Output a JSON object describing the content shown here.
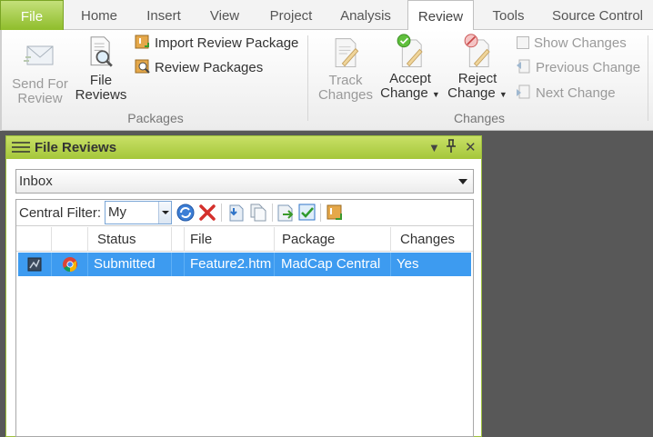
{
  "ribbon_tabs": [
    "File",
    "Home",
    "Insert",
    "View",
    "Project",
    "Analysis",
    "Review",
    "Tools",
    "Source Control"
  ],
  "active_tab": "Review",
  "ribbon": {
    "packages": {
      "send_for_review": [
        "Send For",
        "Review"
      ],
      "file_reviews": [
        "File",
        "Reviews"
      ],
      "import_review_package": "Import Review Package",
      "review_packages": "Review Packages",
      "group_label": "Packages"
    },
    "changes": {
      "track_changes": [
        "Track",
        "Changes"
      ],
      "accept_change": [
        "Accept",
        "Change"
      ],
      "reject_change": [
        "Reject",
        "Change"
      ],
      "show_changes": "Show Changes",
      "previous_change": "Previous Change",
      "next_change": "Next Change",
      "group_label": "Changes"
    }
  },
  "panel": {
    "title": "File Reviews",
    "inbox_value": "Inbox",
    "filter_label": "Central Filter:",
    "filter_value": "My",
    "columns": [
      "Status",
      "File",
      "Package",
      "Changes"
    ],
    "rows": [
      {
        "status": "Submitted",
        "file": "Feature2.htm",
        "package": "MadCap Central",
        "changes": "Yes"
      }
    ]
  },
  "colors": {
    "accent_green": "#a5c73a",
    "selection_blue": "#3d9bf0",
    "workspace": "#585858"
  }
}
